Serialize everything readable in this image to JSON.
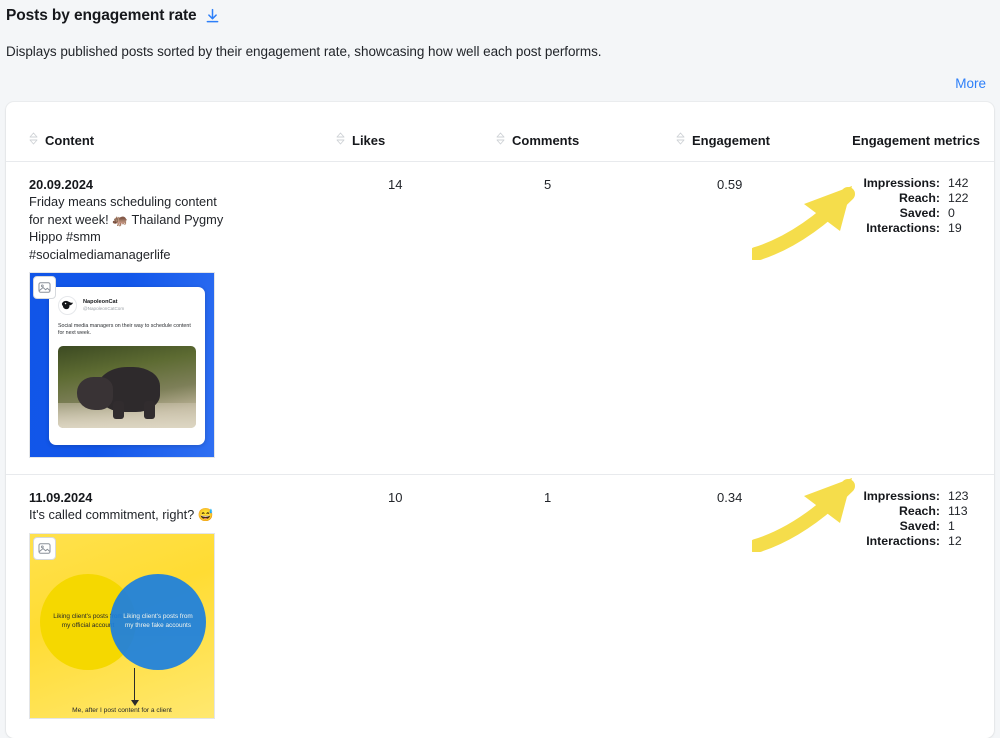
{
  "header": {
    "title": "Posts by engagement rate",
    "download_icon": "download-icon",
    "description": "Displays published posts sorted by their engagement rate, showcasing how well each post performs.",
    "more_label": "More",
    "link_color": "#2d7ff9"
  },
  "table": {
    "columns": [
      {
        "label": "Content",
        "sortable": true
      },
      {
        "label": "Likes",
        "sortable": true
      },
      {
        "label": "Comments",
        "sortable": true
      },
      {
        "label": "Engagement",
        "sortable": true
      },
      {
        "label": "Engagement metrics",
        "sortable": false
      }
    ],
    "metric_labels": {
      "impressions": "Impressions:",
      "reach": "Reach:",
      "saved": "Saved:",
      "interactions": "Interactions:"
    },
    "rows": [
      {
        "date": "20.09.2024",
        "text": "Friday means scheduling content for next week! 🦛 Thailand Pygmy Hippo #smm #socialmediamanagerlife",
        "likes": "14",
        "comments": "5",
        "engagement": "0.59",
        "metrics": {
          "impressions": "142",
          "reach": "122",
          "saved": "0",
          "interactions": "19"
        },
        "thumbnail": {
          "kind": "tweet-card",
          "account_name": "NapoleonCat",
          "account_handle": "@NapoleonCatCom",
          "tweet_text": "Social media managers on their way to schedule content for next week.",
          "background_color": "#1155e8"
        }
      },
      {
        "date": "11.09.2024",
        "text": "It's called commitment, right? 😅",
        "likes": "10",
        "comments": "1",
        "engagement": "0.34",
        "metrics": {
          "impressions": "123",
          "reach": "113",
          "saved": "1",
          "interactions": "12"
        },
        "thumbnail": {
          "kind": "venn-meme",
          "left_circle_text": "Liking client's posts from my official account",
          "right_circle_text": "Liking client's posts from my three fake accounts",
          "caption": "Me, after I post content for a client",
          "background_color": "#ffdc33",
          "left_circle_color": "#f5d800",
          "right_circle_color": "#1b7fe0"
        }
      }
    ]
  },
  "annotations": {
    "arrow_color": "#f5dd4b",
    "arrows": [
      {
        "name": "highlight-arrow-row-1",
        "points_to": "engagement-metrics-row-1"
      },
      {
        "name": "highlight-arrow-row-2",
        "points_to": "engagement-metrics-row-2"
      }
    ]
  }
}
